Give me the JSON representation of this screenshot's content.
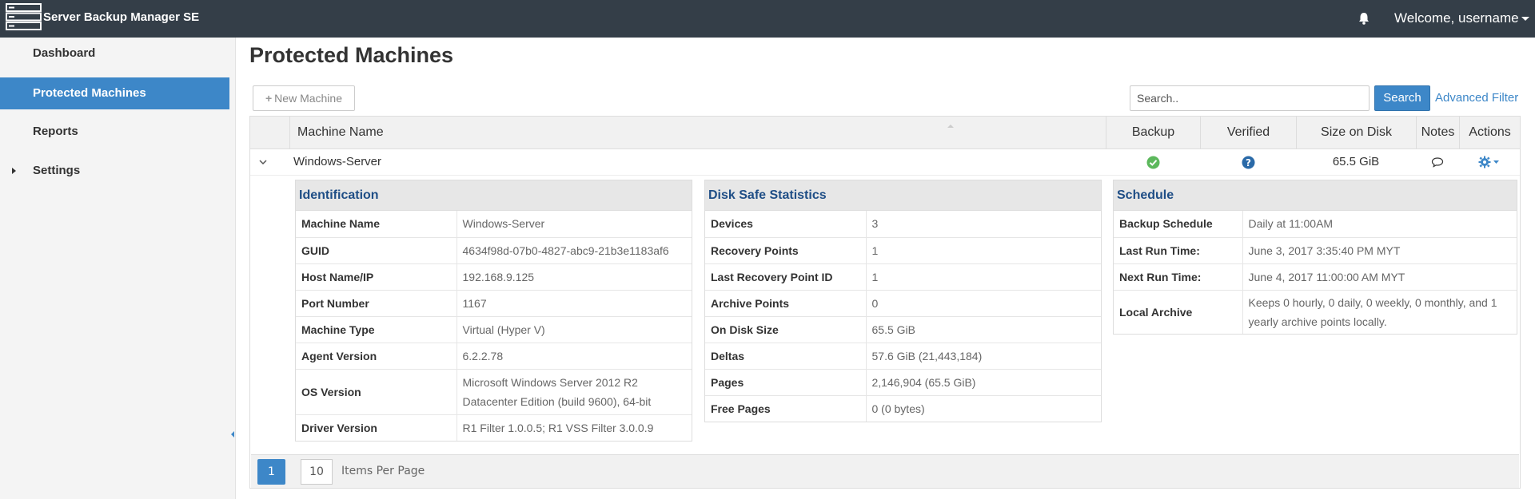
{
  "app": {
    "title": "Server Backup Manager SE",
    "welcome": "Welcome, username"
  },
  "sidebar": {
    "items": [
      {
        "label": "Dashboard"
      },
      {
        "label": "Protected Machines"
      },
      {
        "label": "Reports"
      },
      {
        "label": "Settings"
      }
    ],
    "active": "Protected Machines"
  },
  "page": {
    "title": "Protected Machines"
  },
  "toolbar": {
    "new_machine_label": "New Machine",
    "search_placeholder": "Search..",
    "search_label": "Search",
    "advanced_filter_label": "Advanced Filter"
  },
  "table": {
    "columns": [
      "Machine Name",
      "Backup",
      "Verified",
      "Size on Disk",
      "Notes",
      "Actions"
    ],
    "rows": [
      {
        "machine_name": "Windows-Server",
        "backup": "ok",
        "verified": "unknown",
        "size_on_disk": "65.5 GiB"
      }
    ]
  },
  "identification": {
    "title": "Identification",
    "rows": [
      {
        "k": "Machine Name",
        "v": "Windows-Server"
      },
      {
        "k": "GUID",
        "v": "4634f98d-07b0-4827-abc9-21b3e1183af6"
      },
      {
        "k": "Host Name/IP",
        "v": "192.168.9.125"
      },
      {
        "k": "Port Number",
        "v": "1167"
      },
      {
        "k": "Machine Type",
        "v": "Virtual (Hyper V)"
      },
      {
        "k": "Agent Version",
        "v": "6.2.2.78"
      },
      {
        "k": "OS Version",
        "v": "Microsoft Windows Server 2012 R2 Datacenter Edition (build 9600), 64-bit"
      },
      {
        "k": "Driver Version",
        "v": "R1 Filter 1.0.0.5; R1 VSS Filter 3.0.0.9"
      }
    ]
  },
  "disk_safe": {
    "title": "Disk Safe Statistics",
    "rows": [
      {
        "k": "Devices",
        "v": "3"
      },
      {
        "k": "Recovery Points",
        "v": "1"
      },
      {
        "k": "Last Recovery Point ID",
        "v": "1"
      },
      {
        "k": "Archive Points",
        "v": "0"
      },
      {
        "k": "On Disk Size",
        "v": "65.5 GiB"
      },
      {
        "k": "Deltas",
        "v": "57.6 GiB (21,443,184)"
      },
      {
        "k": "Pages",
        "v": "2,146,904 (65.5 GiB)"
      },
      {
        "k": "Free Pages",
        "v": "0 (0 bytes)"
      }
    ]
  },
  "schedule": {
    "title": "Schedule",
    "rows": [
      {
        "k": "Backup Schedule",
        "v": "Daily at 11:00AM"
      },
      {
        "k": "Last Run Time:",
        "v": "June 3, 2017 3:35:40 PM MYT"
      },
      {
        "k": "Next Run Time:",
        "v": "June 4, 2017 11:00:00 AM MYT"
      },
      {
        "k": "Local Archive",
        "v": "Keeps 0 hourly, 0 daily, 0 weekly, 0 monthly, and 1 yearly archive points locally."
      }
    ]
  },
  "pager": {
    "current_page": "1",
    "items_per_page": "10",
    "items_per_page_label": "Items Per Page"
  },
  "colors": {
    "topbar": "#343e48",
    "accent": "#3d87c8",
    "ok": "#5cb85c",
    "panel_title": "#1f4e86"
  }
}
